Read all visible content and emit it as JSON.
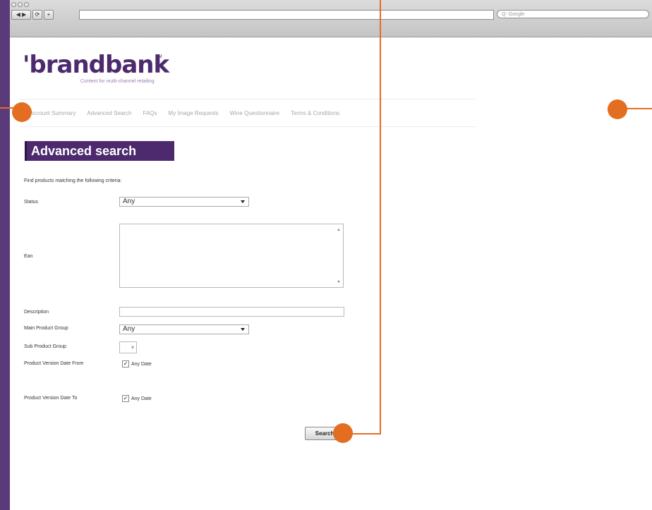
{
  "browser": {
    "traffic_lights": "●●●",
    "back_label": "◀ ▶",
    "refresh_label": "⟳",
    "add_label": "+",
    "search_placeholder": "Q- Google",
    "accent": "#4d2a6e",
    "annotation_color": "#e36e22"
  },
  "logo": {
    "text": "'brandbank",
    "tm": "TM",
    "tagline": "Content for multi-channel retailing"
  },
  "nav": {
    "items": [
      "Account Summary",
      "Advanced Search",
      "FAQs",
      "My Image Requests",
      "Wine Questionnaire",
      "Terms & Conditions"
    ]
  },
  "page": {
    "title": "Advanced search",
    "intro": "Find products matching the following criteria:"
  },
  "form": {
    "status_label": "Status",
    "status_value": "Any",
    "ean_label": "Ean",
    "description_label": "Description",
    "main_group_label": "Main Product Group",
    "main_group_value": "Any",
    "sub_group_label": "Sub Product Group",
    "date_from_label": "Product Version Date From",
    "date_to_label": "Product Version Date To",
    "any_date_label": "Any Date",
    "check_mark": "✓",
    "sub_select_arrow": "▾",
    "search_button": "Search"
  }
}
